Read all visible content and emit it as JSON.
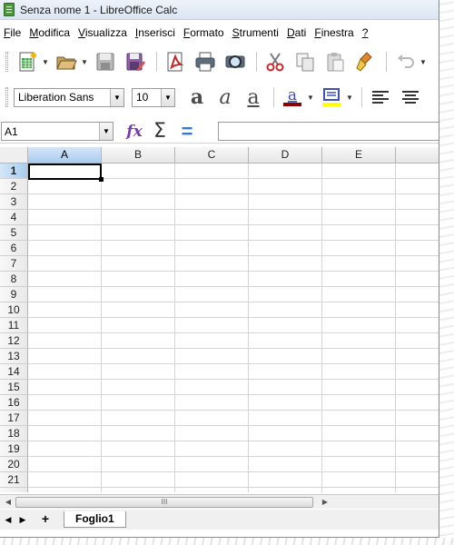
{
  "window": {
    "title": "Senza nome 1 - LibreOffice Calc"
  },
  "menubar": {
    "items": [
      {
        "u": "F",
        "rest": "ile"
      },
      {
        "u": "M",
        "rest": "odifica"
      },
      {
        "u": "V",
        "rest": "isualizza"
      },
      {
        "u": "I",
        "rest": "nserisci"
      },
      {
        "u": "F",
        "rest": "ormato"
      },
      {
        "u": "S",
        "rest": "trumenti"
      },
      {
        "u": "D",
        "rest": "ati"
      },
      {
        "u": "F",
        "rest": "inestra"
      },
      {
        "u": "?",
        "rest": ""
      }
    ]
  },
  "toolbar": {
    "icons": [
      "new-spreadsheet-icon",
      "open-folder-icon",
      "save-icon",
      "save-as-icon",
      "export-pdf-icon",
      "print-icon",
      "print-preview-icon",
      "cut-icon",
      "copy-icon",
      "paste-icon",
      "clone-formatting-icon",
      "undo-icon"
    ]
  },
  "formatting": {
    "font_name": "Liberation Sans",
    "font_size": "10",
    "font_color": "#8b0000",
    "highlight_color": "#ffff00"
  },
  "formula_bar": {
    "cell_ref": "A1",
    "content": ""
  },
  "sheet": {
    "columns": [
      "A",
      "B",
      "C",
      "D",
      "E"
    ],
    "rows": [
      "1",
      "2",
      "3",
      "4",
      "5",
      "6",
      "7",
      "8",
      "9",
      "10",
      "11",
      "12",
      "13",
      "14",
      "15",
      "16",
      "17",
      "18",
      "19",
      "20",
      "21"
    ],
    "active_column": "A",
    "active_row": "1"
  },
  "scrollbar": {
    "thumb_label": "III"
  },
  "tabs": {
    "sheets": [
      "Foglio1"
    ],
    "active": "Foglio1"
  }
}
